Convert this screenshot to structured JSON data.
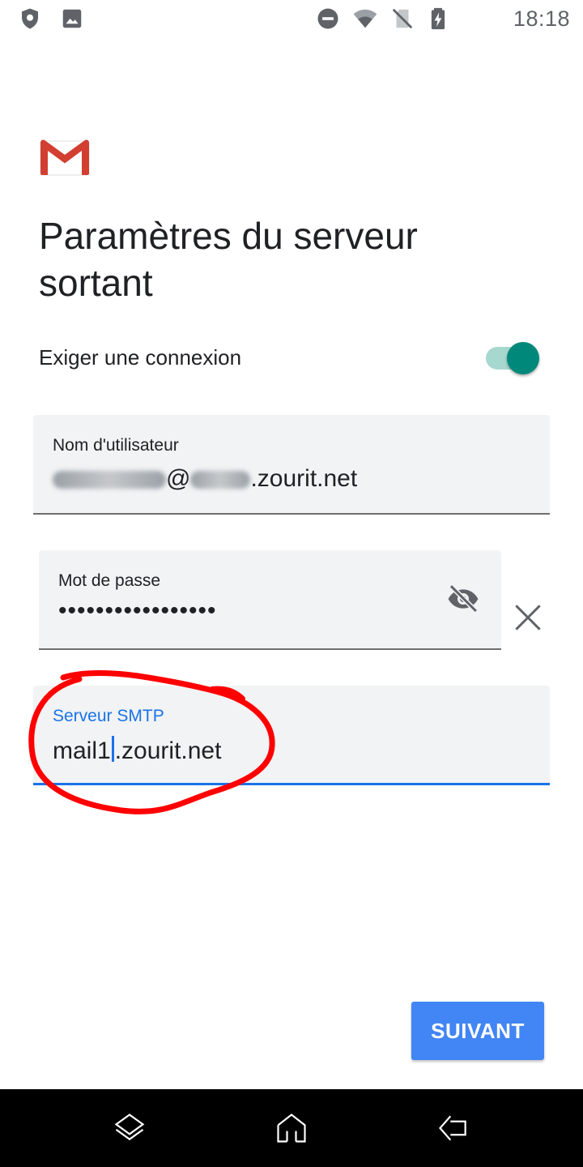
{
  "status_bar": {
    "time": "18:18",
    "left_icons": [
      "shield-icon",
      "image-icon"
    ],
    "right_icons": [
      "do-not-disturb-icon",
      "wifi-icon",
      "no-sim-icon",
      "battery-charging-icon"
    ]
  },
  "logo": "gmail-logo",
  "title": "Paramètres du serveur sortant",
  "require_login": {
    "label": "Exiger une connexion",
    "enabled": true
  },
  "username_field": {
    "label": "Nom d'utilisateur",
    "value_visible_part_1": "@",
    "value_visible_part_2": ".zourit.net"
  },
  "password_field": {
    "label": "Mot de passe",
    "value": "•••••••••••••••••"
  },
  "smtp_field": {
    "label": "Serveur SMTP",
    "value_before_cursor": "mail1",
    "value_after_cursor": ".zourit.net"
  },
  "next_button": {
    "label": "SUIVANT"
  },
  "nav_bar": {
    "icons": [
      "recents-icon",
      "home-icon",
      "back-icon"
    ]
  },
  "colors": {
    "accent": "#4285f4",
    "focus": "#1a73e8",
    "toggle": "#00897b",
    "annotation": "#ff0000"
  }
}
